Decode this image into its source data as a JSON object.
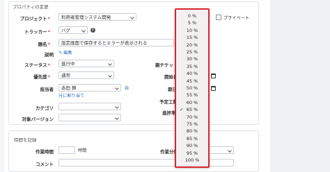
{
  "legend_properties": "プロパティの変更",
  "legend_time": "時間を記録",
  "fields": {
    "project": {
      "label": "プロジェクト",
      "value": "利用者管理システム開発"
    },
    "private_label": "プライベート",
    "tracker": {
      "label": "トラッカー",
      "value": "バグ"
    },
    "subject": {
      "label": "題名",
      "value": "設定画面で保存するとエラーが表示される"
    },
    "description": {
      "label": "説明",
      "edit_link": "編集"
    },
    "status": {
      "label": "ステータス",
      "value": "進行中"
    },
    "priority": {
      "label": "優先度",
      "value": "通常"
    },
    "assignee": {
      "label": "担当者",
      "value": "赤田 舞",
      "assign_me": "分に割り当て",
      "extra": "自"
    },
    "category": {
      "label": "カテゴリ"
    },
    "version": {
      "label": "対象バージョン"
    },
    "parent_task": {
      "label": "親チケット"
    },
    "start_date": {
      "label": "開始日"
    },
    "due_date": {
      "label": "期日"
    },
    "estimated": {
      "label": "予定工数"
    },
    "done_ratio": {
      "label": "進捗率"
    },
    "time_spent": {
      "label": "作業時間",
      "unit": "時間"
    },
    "activity": {
      "label": "作業分類"
    },
    "comment": {
      "label": "コメント"
    }
  },
  "dropdown": {
    "options": [
      "0 %",
      "5 %",
      "10 %",
      "15 %",
      "20 %",
      "25 %",
      "30 %",
      "35 %",
      "40 %",
      "45 %",
      "50 %",
      "55 %",
      "60 %",
      "65 %",
      "70 %",
      "75 %",
      "80 %",
      "85 %",
      "90 %",
      "95 %",
      "100 %"
    ],
    "selected": "65 %",
    "check_mark": "✓",
    "highlight_color": "#d8262d"
  }
}
